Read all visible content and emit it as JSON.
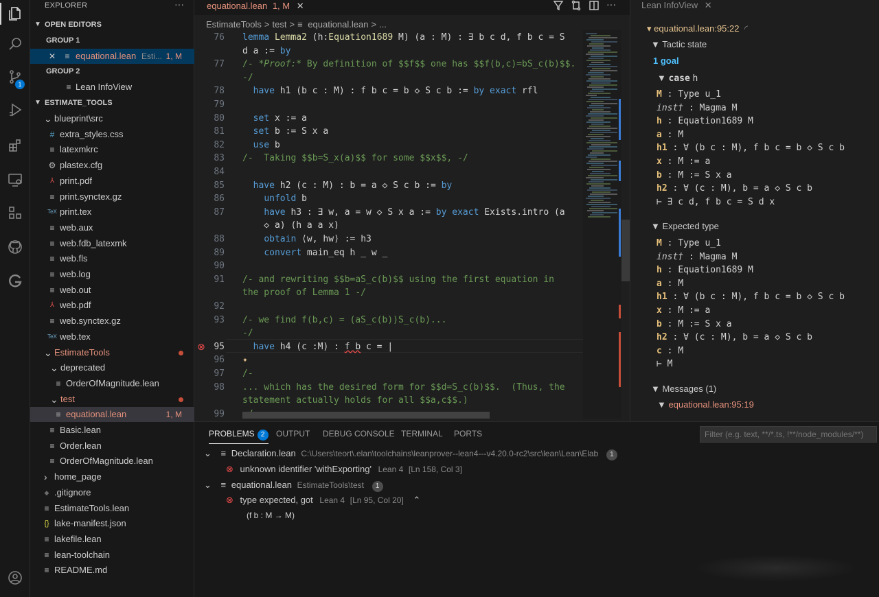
{
  "activity_icons": [
    "explorer-icon",
    "search-icon",
    "source-control-icon",
    "run-debug-icon",
    "extensions-icon",
    "remote-explorer-icon",
    "testing-icon",
    "github-icon",
    "gitlens-icon",
    "account-icon"
  ],
  "scm_badge": "1",
  "explorer": {
    "title": "EXPLORER",
    "more": "···",
    "open_editors": "OPEN EDITORS",
    "group1": "GROUP 1",
    "group1_file": "equational.lean",
    "group1_desc": "Esti...",
    "group1_status": "1, M",
    "group2": "GROUP 2",
    "group2_file": "Lean InfoView",
    "project": "ESTIMATE_TOOLS",
    "tree": [
      {
        "label": "blueprint\\src",
        "indent": 1,
        "twisty": "v"
      },
      {
        "label": "extra_styles.css",
        "indent": 2,
        "icon": "#"
      },
      {
        "label": "latexmkrc",
        "indent": 2,
        "icon": "≡"
      },
      {
        "label": "plastex.cfg",
        "indent": 2,
        "icon": "⚙"
      },
      {
        "label": "print.pdf",
        "indent": 2,
        "icon": "pdf"
      },
      {
        "label": "print.synctex.gz",
        "indent": 2,
        "icon": "≡"
      },
      {
        "label": "print.tex",
        "indent": 2,
        "icon": "TeX"
      },
      {
        "label": "web.aux",
        "indent": 2,
        "icon": "≡"
      },
      {
        "label": "web.fdb_latexmk",
        "indent": 2,
        "icon": "≡"
      },
      {
        "label": "web.fls",
        "indent": 2,
        "icon": "≡"
      },
      {
        "label": "web.log",
        "indent": 2,
        "icon": "≡"
      },
      {
        "label": "web.out",
        "indent": 2,
        "icon": "≡"
      },
      {
        "label": "web.pdf",
        "indent": 2,
        "icon": "pdf"
      },
      {
        "label": "web.synctex.gz",
        "indent": 2,
        "icon": "≡"
      },
      {
        "label": "web.tex",
        "indent": 2,
        "icon": "TeX"
      },
      {
        "label": "EstimateTools",
        "indent": 1,
        "twisty": "v",
        "modified": true
      },
      {
        "label": "deprecated",
        "indent": 2,
        "twisty": "v"
      },
      {
        "label": "OrderOfMagnitude.lean",
        "indent": 3,
        "icon": "≡"
      },
      {
        "label": "test",
        "indent": 2,
        "twisty": "v",
        "modified": true
      },
      {
        "label": "equational.lean",
        "indent": 3,
        "icon": "≡",
        "selected": true,
        "status": "1, M"
      },
      {
        "label": "Basic.lean",
        "indent": 2,
        "icon": "≡"
      },
      {
        "label": "Order.lean",
        "indent": 2,
        "icon": "≡"
      },
      {
        "label": "OrderOfMagnitude.lean",
        "indent": 2,
        "icon": "≡"
      },
      {
        "label": "home_page",
        "indent": 1,
        "twisty": ">"
      },
      {
        "label": ".gitignore",
        "indent": 1,
        "icon": "◆"
      },
      {
        "label": "EstimateTools.lean",
        "indent": 1,
        "icon": "≡"
      },
      {
        "label": "lake-manifest.json",
        "indent": 1,
        "icon": "{}"
      },
      {
        "label": "lakefile.lean",
        "indent": 1,
        "icon": "≡"
      },
      {
        "label": "lean-toolchain",
        "indent": 1,
        "icon": "≡"
      },
      {
        "label": "README.md",
        "indent": 1,
        "icon": "≡"
      }
    ]
  },
  "editor": {
    "tab_label": "equational.lean",
    "tab_status": "1, M",
    "breadcrumbs": [
      "EstimateTools",
      ">",
      "test",
      ">",
      "equational.lean",
      ">",
      "..."
    ],
    "lines": [
      {
        "n": "76",
        "html": "<span class='k'>lemma</span> <span class='f'>Lemma2</span> (h:<span class='f'>Equation1689</span> M) (a : M) : ∃ b c d, f b c = S"
      },
      {
        "n": "",
        "html": "d a := <span class='k'>by</span>"
      },
      {
        "n": "77",
        "html": "<span class='c'>/- </span><span class='ci'>*Proof:*</span><span class='c'> By definition of $$f$$ one has $$f(b,c)=bS_c(b)$$.</span>"
      },
      {
        "n": "",
        "html": "<span class='c'>-/</span>"
      },
      {
        "n": "78",
        "html": "  <span class='k'>have</span> h1 (b c : M) : f b c = b ◇ S c b := <span class='k'>by</span> <span class='k'>exact</span> rfl"
      },
      {
        "n": "79",
        "html": ""
      },
      {
        "n": "80",
        "html": "  <span class='k'>set</span> x := a"
      },
      {
        "n": "81",
        "html": "  <span class='k'>set</span> b := S x a"
      },
      {
        "n": "82",
        "html": "  <span class='k'>use</span> b"
      },
      {
        "n": "83",
        "html": "<span class='c'>/-  Taking $$b=S_x(a)$$ for some $$x$$, -/</span>"
      },
      {
        "n": "84",
        "html": ""
      },
      {
        "n": "85",
        "html": "  <span class='k'>have</span> h2 (c : M) : b = a ◇ S c b := <span class='k'>by</span>"
      },
      {
        "n": "86",
        "html": "    <span class='k'>unfold</span> b"
      },
      {
        "n": "87",
        "html": "    <span class='k'>have</span> h3 : ∃ w, a = w ◇ S x a := <span class='k'>by</span> <span class='k'>exact</span> Exists.intro (a"
      },
      {
        "n": "",
        "html": "    ◇ a) (h a a x)"
      },
      {
        "n": "88",
        "html": "    <span class='k'>obtain</span> ⟨w, hw⟩ := h3"
      },
      {
        "n": "89",
        "html": "    <span class='k'>convert</span> main_eq h _ w _"
      },
      {
        "n": "90",
        "html": ""
      },
      {
        "n": "91",
        "html": "<span class='c'>/- and rewriting $$b=aS_c(b)$$ using the first equation in</span>"
      },
      {
        "n": "",
        "html": "<span class='c'>the proof of Lemma 1 -/</span>"
      },
      {
        "n": "92",
        "html": ""
      },
      {
        "n": "93",
        "html": "<span class='c'>/- we find f(b,c) = (aS_c(b))S_c(b)...</span>"
      },
      {
        "n": "",
        "html": "<span class='c'>-/</span>"
      },
      {
        "n": "95",
        "html": "  <span class='k'>have</span> h4 (c :M) : <span style='text-decoration: underline wavy #f14c4c'>f b</span> c = |",
        "cur": true
      },
      {
        "n": "96",
        "html": "<span style='color:#e2c08d'>✦</span>"
      },
      {
        "n": "97",
        "html": "<span class='c'>/-</span>"
      },
      {
        "n": "98",
        "html": "<span class='c'>... which has the desired form for $$d=S_c(b)$$.  (Thus, the</span>"
      },
      {
        "n": "",
        "html": "<span class='c'>statement actually holds for all $$a,c$$.)</span>"
      },
      {
        "n": "99",
        "html": "<span class='c'>-/</span>"
      }
    ]
  },
  "infoview": {
    "tab_label": "Lean InfoView",
    "location": "equational.lean:95:22",
    "tactic_state": "Tactic state",
    "goals": "1 goal",
    "case": "case",
    "case_name": "h",
    "goal_hyps": [
      {
        "name": "M",
        "type": "Type u_1"
      },
      {
        "name": "inst†",
        "type": "Magma M",
        "italic": true
      },
      {
        "name": "h",
        "type": "Equation1689 M"
      },
      {
        "name": "a",
        "type": "M"
      },
      {
        "name": "h1",
        "type": "∀ (b c : M), f b c = b ◇ S c b"
      },
      {
        "name": "x",
        "type": "M := a"
      },
      {
        "name": "b",
        "type": "M := S x a"
      },
      {
        "name": "h2",
        "type": "∀ (c : M), b = a ◇ S c b"
      }
    ],
    "goal_target": "⊢ ∃ c d, f b c = S d x",
    "expected_type": "Expected type",
    "expected_hyps": [
      {
        "name": "M",
        "type": "Type u_1"
      },
      {
        "name": "inst†",
        "type": "Magma M",
        "italic": true
      },
      {
        "name": "h",
        "type": "Equation1689 M"
      },
      {
        "name": "a",
        "type": "M"
      },
      {
        "name": "h1",
        "type": "∀ (b c : M), f b c = b ◇ S c b"
      },
      {
        "name": "x",
        "type": "M := a"
      },
      {
        "name": "b",
        "type": "M := S x a"
      },
      {
        "name": "h2",
        "type": "∀ (c : M), b = a ◇ S c b"
      },
      {
        "name": "c",
        "type": "M"
      }
    ],
    "expected_target": "⊢ M",
    "messages": "Messages (1)",
    "message_loc": "equational.lean:95:19"
  },
  "panel": {
    "tabs": [
      "PROBLEMS",
      "OUTPUT",
      "DEBUG CONSOLE",
      "TERMINAL",
      "PORTS"
    ],
    "problems_count": "2",
    "filter_placeholder": "Filter (e.g. text, **/*.ts, !**/node_modules/**)",
    "groups": [
      {
        "file": "Declaration.lean",
        "path": "C:\\Users\\teort\\.elan\\toolchains\\leanprover--lean4---v4.20.0-rc2\\src\\lean\\Lean\\Elab",
        "count": "1",
        "items": [
          {
            "msg": "unknown identifier 'withExporting'",
            "src": "Lean 4",
            "loc": "[Ln 158, Col 3]"
          }
        ]
      },
      {
        "file": "equational.lean",
        "path": "EstimateTools\\test",
        "count": "1",
        "items": [
          {
            "msg": "type expected, got",
            "src": "Lean 4",
            "loc": "[Ln 95, Col 20]",
            "detail": "(f b : M → M)"
          }
        ]
      }
    ]
  }
}
